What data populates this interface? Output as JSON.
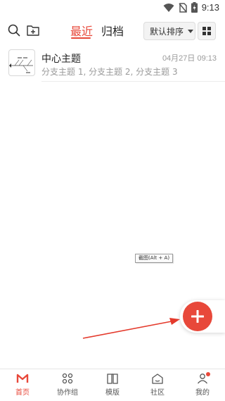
{
  "status_bar": {
    "time": "9:13"
  },
  "toolbar": {
    "tabs": [
      {
        "label": "最近",
        "active": true
      },
      {
        "label": "归档",
        "active": false
      }
    ],
    "sort_label": "默认排序"
  },
  "files": [
    {
      "title": "中心主题",
      "date": "04月27日 09:13",
      "subtitle": "分支主题 1, 分支主题 2, 分支主题 3"
    }
  ],
  "tooltip": "截图(Alt + A)",
  "bottom_nav": [
    {
      "label": "首页",
      "icon": "home-logo-icon",
      "active": true
    },
    {
      "label": "协作组",
      "icon": "team-icon",
      "active": false
    },
    {
      "label": "模版",
      "icon": "template-book-icon",
      "active": false
    },
    {
      "label": "社区",
      "icon": "community-icon",
      "active": false
    },
    {
      "label": "我的",
      "icon": "profile-icon",
      "active": false,
      "badge": true
    }
  ],
  "colors": {
    "accent": "#e8483a",
    "muted_text": "#9a9a9a"
  }
}
